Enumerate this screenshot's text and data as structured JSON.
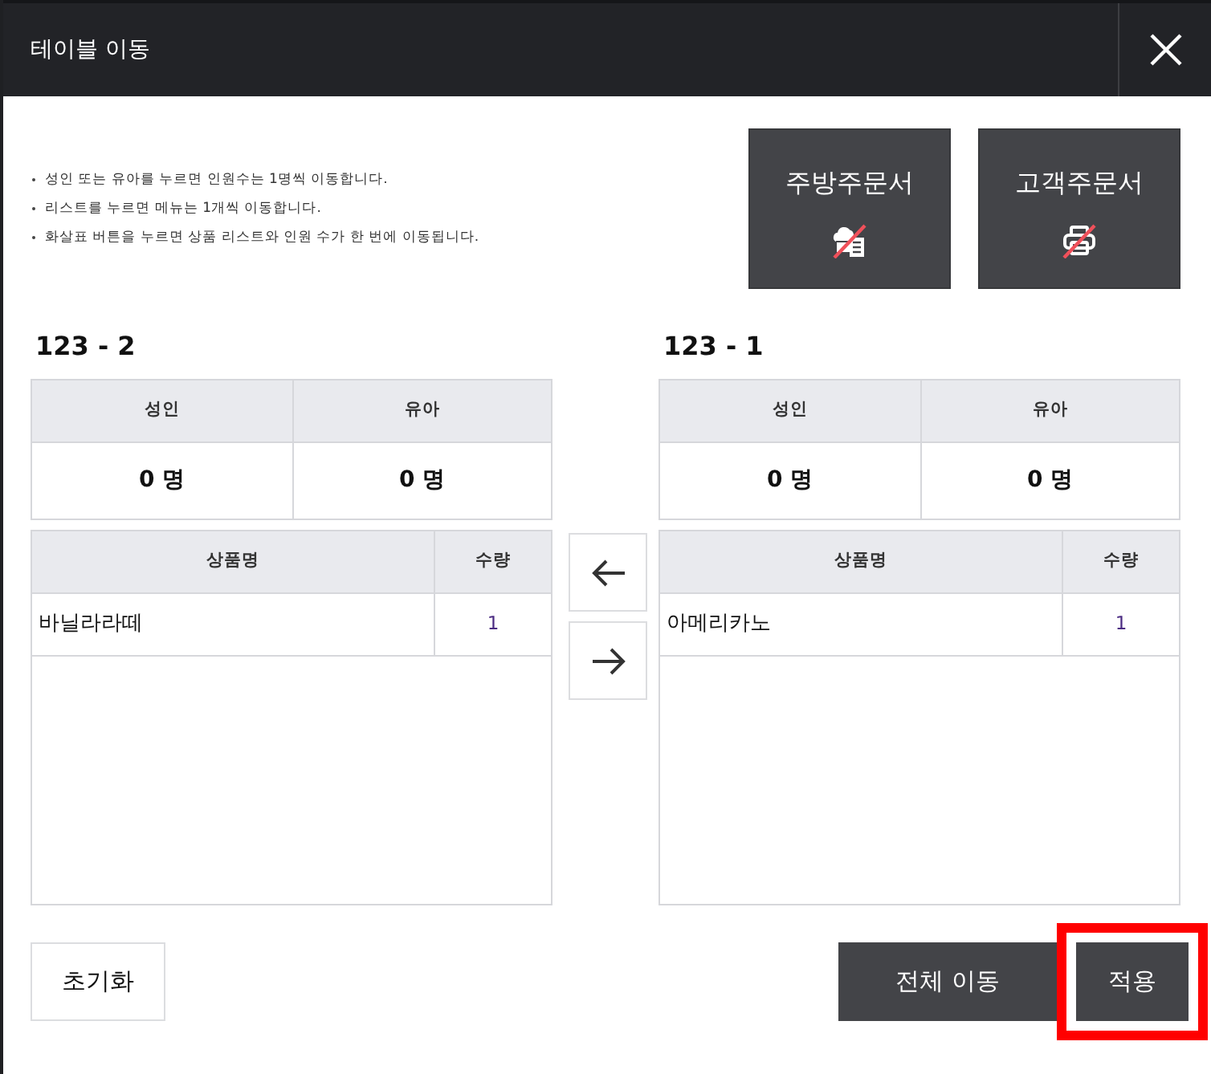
{
  "window": {
    "title": "테이블 이동"
  },
  "notes": [
    "성인 또는 유아를 누르면 인원수는 1명씩 이동합니다.",
    "리스트를 누르면 메뉴는 1개씩 이동합니다.",
    "화살표 버튼을 누르면 상품 리스트와 인원 수가 한 번에 이동됩니다."
  ],
  "print_buttons": [
    {
      "label": "주방주문서",
      "kind": "kitchen",
      "enabled": false
    },
    {
      "label": "고객주문서",
      "kind": "customer",
      "enabled": false
    }
  ],
  "tables": [
    {
      "name": "123 - 2",
      "guests": [
        {
          "label": "성인",
          "count": "0 명"
        },
        {
          "label": "유아",
          "count": "0 명"
        }
      ],
      "columns": [
        "상품명",
        "수량"
      ],
      "items": [
        {
          "name": "바닐라라떼",
          "quantity": "1"
        }
      ]
    },
    {
      "name": "123 - 1",
      "guests": [
        {
          "label": "성인",
          "count": "0 명"
        },
        {
          "label": "유아",
          "count": "0 명"
        }
      ],
      "columns": [
        "상품명",
        "수량"
      ],
      "items": [
        {
          "name": "아메리카노",
          "quantity": "1"
        }
      ]
    }
  ],
  "footer_buttons": [
    {
      "label": "초기화",
      "kind": "reset",
      "highlighted": false
    },
    {
      "label": "전체 이동",
      "kind": "move_all",
      "highlighted": false
    },
    {
      "label": "적용",
      "kind": "apply",
      "highlighted": true
    }
  ]
}
